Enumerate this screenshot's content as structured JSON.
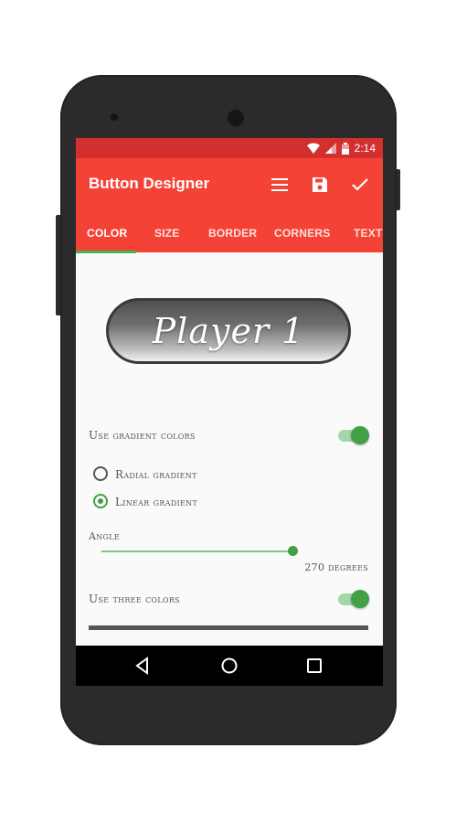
{
  "status_bar": {
    "time": "2:14"
  },
  "app_bar": {
    "title": "Button Designer",
    "actions": [
      "menu-icon",
      "save-icon",
      "check-icon"
    ]
  },
  "tabs": [
    {
      "label": "COLOR",
      "active": true
    },
    {
      "label": "SIZE",
      "active": false
    },
    {
      "label": "BORDER",
      "active": false
    },
    {
      "label": "CORNERS",
      "active": false
    },
    {
      "label": "TEXT",
      "active": false
    }
  ],
  "preview": {
    "text": "Player 1"
  },
  "settings": {
    "use_gradient": {
      "label": "Use gradient colors",
      "on": true
    },
    "radial": {
      "label": "Radial gradient",
      "checked": false
    },
    "linear": {
      "label": "Linear gradient",
      "checked": true
    },
    "angle": {
      "label": "Angle",
      "value_text": "270 degrees",
      "value": 270,
      "max": 360
    },
    "use_three": {
      "label": "Use three colors",
      "on": true
    }
  },
  "colors": {
    "status_bar": "#d32f2f",
    "app_bar": "#f44336",
    "accent": "#43a047"
  }
}
